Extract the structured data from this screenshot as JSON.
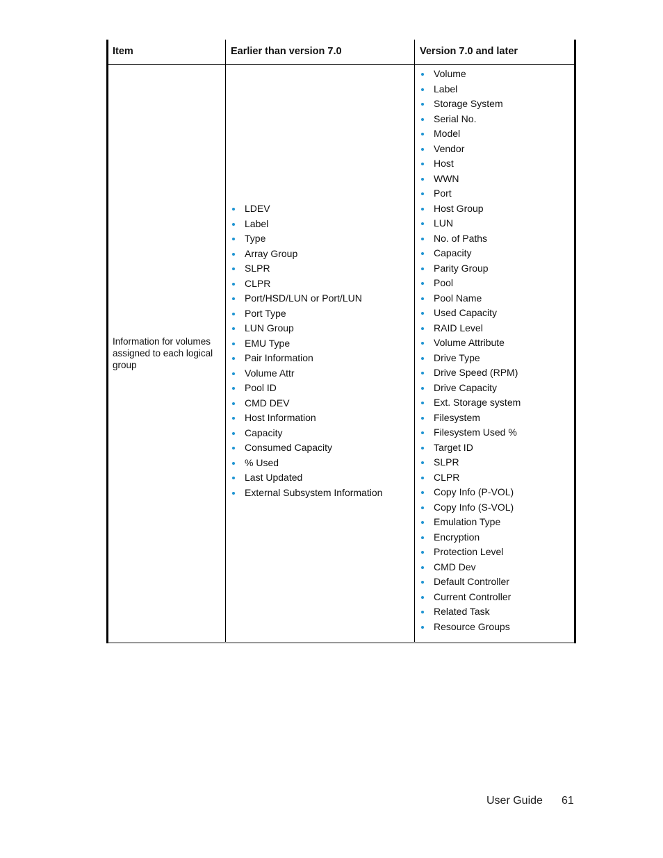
{
  "table": {
    "headers": [
      "Item",
      "Earlier than version 7.0",
      "Version 7.0 and later"
    ],
    "row": {
      "item": "Information for volumes assigned to each logical group",
      "earlier": [
        "LDEV",
        "Label",
        "Type",
        "Array Group",
        "SLPR",
        "CLPR",
        "Port/HSD/LUN or Port/LUN",
        "Port Type",
        "LUN Group",
        "EMU Type",
        "Pair Information",
        "Volume Attr",
        "Pool ID",
        "CMD DEV",
        "Host Information",
        "Capacity",
        "Consumed Capacity",
        "% Used",
        "Last Updated",
        "External Subsystem Information"
      ],
      "later": [
        "Volume",
        "Label",
        "Storage System",
        "Serial No.",
        "Model",
        "Vendor",
        "Host",
        "WWN",
        "Port",
        "Host Group",
        "LUN",
        "No. of Paths",
        "Capacity",
        "Parity Group",
        "Pool",
        "Pool Name",
        "Used Capacity",
        "RAID Level",
        "Volume Attribute",
        "Drive Type",
        "Drive Speed (RPM)",
        "Drive Capacity",
        "Ext. Storage system",
        "Filesystem",
        "Filesystem Used %",
        "Target ID",
        "SLPR",
        "CLPR",
        "Copy Info (P-VOL)",
        "Copy Info (S-VOL)",
        "Emulation Type",
        "Encryption",
        "Protection Level",
        "CMD Dev",
        "Default Controller",
        "Current Controller",
        "Related Task",
        "Resource Groups"
      ]
    }
  },
  "footer": {
    "doc_title": "User Guide",
    "page_number": "61"
  },
  "colors": {
    "bullet": "#1f94d2"
  }
}
